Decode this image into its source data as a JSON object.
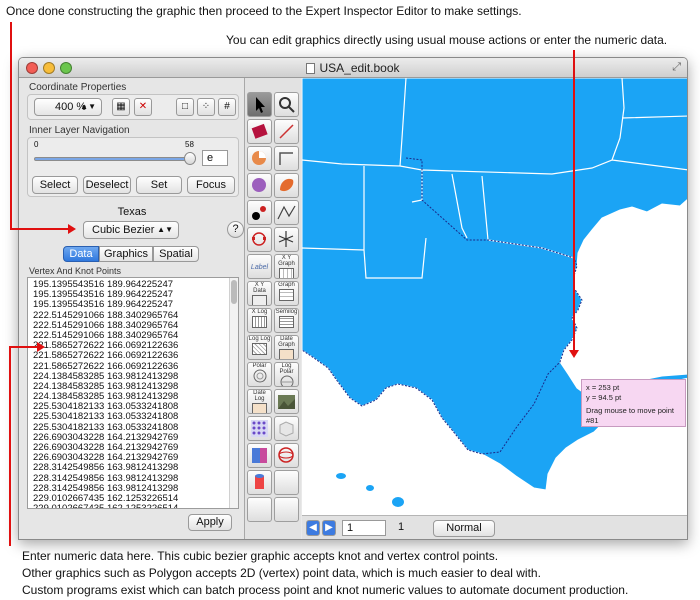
{
  "annotations": {
    "top1": "Once done constructing the graphic then proceed to the Expert Inspector Editor to make settings.",
    "top2": "You can edit graphics directly using usual mouse actions or enter the numeric data.",
    "bottom1": "Enter numeric data here. This cubic bezier graphic accepts knot and vertex control points.",
    "bottom2": "Other graphics such as Polygon accepts 2D (vertex) point data, which is much easier to deal with.",
    "bottom3": "Custom programs exist which can batch process point and knot numeric values to automate document production."
  },
  "window": {
    "title": "USA_edit.book"
  },
  "coordinate_properties": {
    "header": "Coordinate Properties",
    "zoom": "400 %"
  },
  "inner_layer_navigation": {
    "header": "Inner Layer Navigation",
    "slider_min": "0",
    "slider_max": "58",
    "slider_value": 1.0,
    "field_value": "e",
    "buttons": {
      "select": "Select",
      "deselect": "Deselect",
      "set": "Set",
      "focus": "Focus"
    }
  },
  "object": {
    "name": "Texas",
    "type": "Cubic Bezier",
    "help": "?"
  },
  "tabs": [
    "Data",
    "Graphics",
    "Spatial"
  ],
  "vertex_list": {
    "header": "Vertex And Knot Points",
    "rows": [
      "195.1395543516 189.964225247",
      "195.1395543516 189.964225247",
      "195.1395543516 189.964225247",
      "222.5145291066 188.3402965764",
      "222.5145291066 188.3402965764",
      "222.5145291066 188.3402965764",
      "221.5865272622 166.0692122636",
      "221.5865272622 166.0692122636",
      "221.5865272622 166.0692122636",
      "224.1384583285 163.9812413298",
      "224.1384583285 163.9812413298",
      "224.1384583285 163.9812413298",
      "225.5304182133 163.0533241808",
      "225.5304182133 163.0533241808",
      "225.5304182133 163.0533241808",
      "226.6903043228 164.2132942769",
      "226.6903043228 164.2132942769",
      "226.6903043228 164.2132942769",
      "228.3142549856 163.9812413298",
      "228.3142549856 163.9812413298",
      "228.3142549856 163.9812413298",
      "229.0102667435 162.1253226514",
      "229.0102667435 162.1253226514",
      "229.0102667435 162.1253226514"
    ],
    "apply": "Apply"
  },
  "tools": [
    "Label",
    "X Y Graph",
    "X Y Data",
    "Graph",
    "X Log",
    "Semilog",
    "Log Log",
    "Date Graph",
    "Polar",
    "Log Polar",
    "Date Log"
  ],
  "tooltip": {
    "line1": "x = 253 pt",
    "line2": "y = 94.5 pt",
    "line3": "Drag mouse to move point #81"
  },
  "status": {
    "page_field": "1",
    "page_count": "1",
    "mode": "Normal"
  },
  "colors": {
    "map_fill": "#1ba4f5",
    "annotation_line": "#e01010",
    "tooltip_bg": "#f7d7f2"
  }
}
